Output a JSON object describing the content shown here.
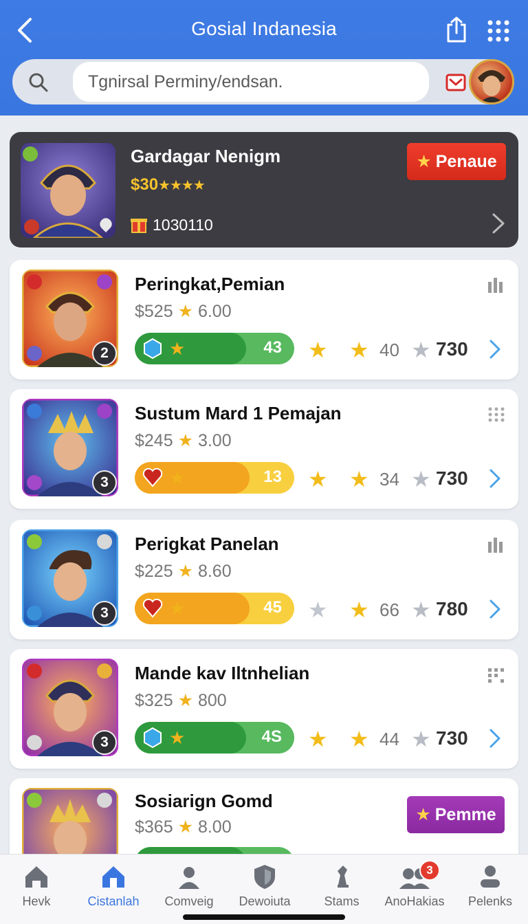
{
  "header": {
    "title": "Gosial Indanesia",
    "back_icon": "chevron-left-icon",
    "share_icon": "share-icon",
    "grid_icon": "grid-dots-icon"
  },
  "search": {
    "placeholder": "Tgnirsal Perminy/endsan.",
    "icon": "search-icon"
  },
  "featured": {
    "name": "Gardagar Nenigm",
    "price": "$30",
    "stars": "★★★★",
    "count": "1030110",
    "button_label": "Penaue",
    "button_color": "#e4352a"
  },
  "cards": [
    {
      "name": "Peringkat,Pemian",
      "price": "$525",
      "rating": "6.00",
      "progress_value": "43",
      "rate_a": "40",
      "rate_b": "730",
      "rank": "2",
      "bar_color": "#3aa44a"
    },
    {
      "name": "Sustum Mard 1 Pemajan",
      "price": "$245",
      "rating": "3.00",
      "progress_value": "13",
      "rate_a": "34",
      "rate_b": "730",
      "rank": "3",
      "bar_color": "#f5b21e"
    },
    {
      "name": "Perigkat Panelan",
      "price": "$225",
      "rating": "8.60",
      "progress_value": "45",
      "rate_a": "66",
      "rate_b": "780",
      "rank": "3",
      "bar_color": "#f5b21e"
    },
    {
      "name": "Mande kav Iltnhelian",
      "price": "$325",
      "rating": "800",
      "progress_value": "4S",
      "rate_a": "44",
      "rate_b": "730",
      "rank": "3",
      "bar_color": "#3aa44a"
    },
    {
      "name": "Sosiarign Gomd",
      "price": "$365",
      "rating": "8.00",
      "button_label": "Pemme"
    }
  ],
  "nav": [
    {
      "label": "Hevk",
      "icon": "home-icon"
    },
    {
      "label": "Cistanlah",
      "icon": "store-icon",
      "active": true
    },
    {
      "label": "Comveig",
      "icon": "user-icon"
    },
    {
      "label": "Dewoiuta",
      "icon": "shield-icon"
    },
    {
      "label": "Stams",
      "icon": "chess-icon"
    },
    {
      "label": "AnoHakias",
      "icon": "group-icon",
      "badge": "3"
    },
    {
      "label": "Pelenks",
      "icon": "profile-icon"
    }
  ]
}
